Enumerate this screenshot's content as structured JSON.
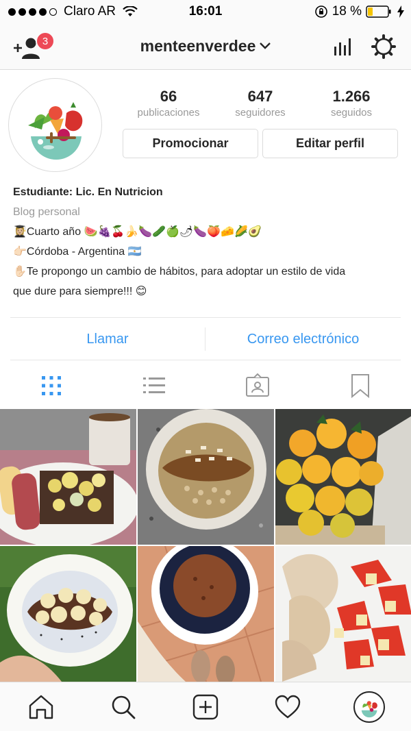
{
  "status_bar": {
    "carrier": "Claro AR",
    "time": "16:01",
    "battery": "18 %"
  },
  "nav": {
    "username": "menteenverdee",
    "follow_badge_count": "3",
    "icons": [
      "add-user-icon",
      "chevron-down-icon",
      "insights-icon",
      "gear-icon"
    ]
  },
  "profile": {
    "stats": [
      {
        "value": "66",
        "label": "publicaciones"
      },
      {
        "value": "647",
        "label": "seguidores"
      },
      {
        "value": "1.266",
        "label": "seguidos"
      }
    ],
    "promote_label": "Promocionar",
    "edit_label": "Editar perfil"
  },
  "bio": {
    "name": "Estudiante: Lic. En Nutricion",
    "category": "Blog personal",
    "line1": "👩🏼‍🎓Cuarto año 🍉🍇🍒🍌🍆🥒🍏🌶🍆🍑🧀🌽🥑",
    "line2": "👉🏻Córdoba - Argentina 🇦🇷",
    "line3": "✋🏻Te propongo un cambio de hábitos, para adoptar un estilo de vida",
    "line4": "que dure para siempre!!! 😊"
  },
  "contact": {
    "call_label": "Llamar",
    "email_label": "Correo electrónico"
  },
  "view_tabs": [
    "grid-icon",
    "list-icon",
    "tagged-icon",
    "saved-icon"
  ],
  "bottom_tabs": [
    "home-icon",
    "search-icon",
    "new-post-icon",
    "activity-icon",
    "profile-avatar"
  ],
  "colors": {
    "accent": "#3897f0",
    "badge": "#ed4956",
    "text": "#262626",
    "muted": "#999999",
    "battery_low": "#f5c400"
  }
}
